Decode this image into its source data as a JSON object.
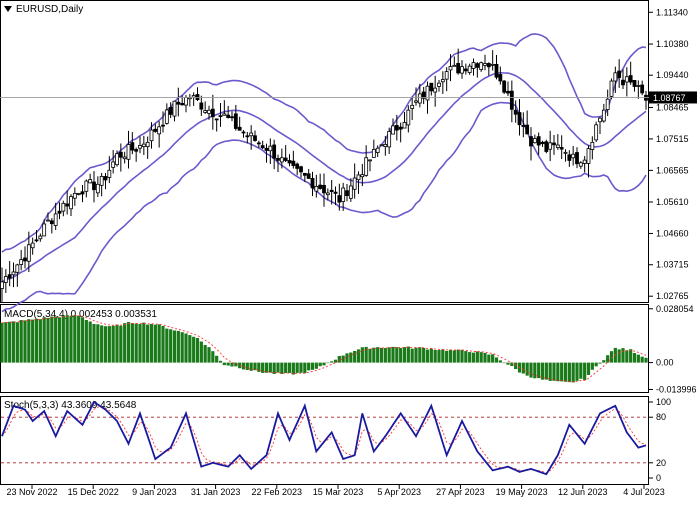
{
  "chart_data": [
    {
      "type": "candlestick",
      "title": "EURUSD,Daily",
      "ylim": [
        1.0262,
        1.1165
      ],
      "y_ticks": [
        "1.11340",
        "1.10380",
        "1.09440",
        "1.08465",
        "1.07515",
        "1.06565",
        "1.05610",
        "1.04660",
        "1.03715",
        "1.02765"
      ],
      "current_price": "1.08767",
      "colors": {
        "candle": "#000000",
        "bollinger": "#6a5acd",
        "price_line": "#9a9a9a"
      },
      "indicators": [
        "Bollinger Bands"
      ]
    },
    {
      "type": "bar",
      "title": "MACD(5,34,4) 0.002453 0.003531",
      "ylim": [
        -0.0148,
        0.0295
      ],
      "y_ticks": [
        "0.028054",
        "0.00",
        "-0.013996"
      ],
      "colors": {
        "histogram": "#1a7a1a",
        "signal": "#ff3333"
      }
    },
    {
      "type": "line",
      "title": "Stoch(5,3,3) 43.3609 43.5648",
      "ylim": [
        0,
        100
      ],
      "y_ticks": [
        "100",
        "80",
        "20",
        "0"
      ],
      "levels": [
        80,
        20
      ],
      "colors": {
        "main": "#1a1aa0",
        "signal": "#ff3333",
        "levels": "#aa2222"
      }
    }
  ],
  "x_ticks": [
    "23 Nov 2022",
    "15 Dec 2022",
    "9 Jan 2023",
    "31 Jan 2023",
    "22 Feb 2023",
    "15 Mar 2023",
    "5 Apr 2023",
    "27 Apr 2023",
    "19 May 2023",
    "12 Jun 2023",
    "4 Jul 2023"
  ],
  "series_anchors": {
    "price": [
      [
        0,
        1.032
      ],
      [
        6,
        1.04
      ],
      [
        12,
        1.05
      ],
      [
        20,
        1.06
      ],
      [
        26,
        1.062
      ],
      [
        30,
        1.07
      ],
      [
        36,
        1.073
      ],
      [
        40,
        1.078
      ],
      [
        45,
        1.085
      ],
      [
        49,
        1.088
      ],
      [
        54,
        1.084
      ],
      [
        58,
        1.082
      ],
      [
        63,
        1.077
      ],
      [
        70,
        1.072
      ],
      [
        75,
        1.066
      ],
      [
        80,
        1.063
      ],
      [
        84,
        1.06
      ],
      [
        88,
        1.057
      ],
      [
        92,
        1.063
      ],
      [
        96,
        1.069
      ],
      [
        100,
        1.075
      ],
      [
        104,
        1.08
      ],
      [
        108,
        1.086
      ],
      [
        112,
        1.091
      ],
      [
        115,
        1.095
      ],
      [
        118,
        1.096
      ],
      [
        122,
        1.098
      ],
      [
        126,
        1.099
      ],
      [
        130,
        1.094
      ],
      [
        134,
        1.083
      ],
      [
        138,
        1.075
      ],
      [
        142,
        1.072
      ],
      [
        146,
        1.073
      ],
      [
        149,
        1.069
      ],
      [
        152,
        1.07
      ],
      [
        155,
        1.079
      ],
      [
        158,
        1.087
      ],
      [
        160,
        1.095
      ],
      [
        162,
        1.093
      ],
      [
        165,
        1.091
      ],
      [
        168,
        1.087
      ]
    ],
    "macd": [
      [
        0,
        0.0205
      ],
      [
        6,
        0.022
      ],
      [
        14,
        0.024
      ],
      [
        20,
        0.0245
      ],
      [
        24,
        0.0205
      ],
      [
        28,
        0.0185
      ],
      [
        34,
        0.021
      ],
      [
        40,
        0.02
      ],
      [
        45,
        0.017
      ],
      [
        50,
        0.014
      ],
      [
        54,
        0.008
      ],
      [
        58,
        -0.001
      ],
      [
        62,
        -0.0025
      ],
      [
        66,
        -0.0045
      ],
      [
        70,
        -0.0055
      ],
      [
        74,
        -0.006
      ],
      [
        78,
        -0.0055
      ],
      [
        82,
        -0.0035
      ],
      [
        86,
        0.001
      ],
      [
        90,
        0.005
      ],
      [
        94,
        0.0075
      ],
      [
        98,
        0.008
      ],
      [
        104,
        0.008
      ],
      [
        110,
        0.0075
      ],
      [
        116,
        0.0065
      ],
      [
        122,
        0.006
      ],
      [
        128,
        0.004
      ],
      [
        132,
        -0.001
      ],
      [
        136,
        -0.006
      ],
      [
        140,
        -0.0085
      ],
      [
        144,
        -0.01
      ],
      [
        148,
        -0.0105
      ],
      [
        152,
        -0.0085
      ],
      [
        156,
        0.0
      ],
      [
        160,
        0.0075
      ],
      [
        164,
        0.0065
      ],
      [
        168,
        0.0025
      ]
    ],
    "stoch": [
      [
        0,
        55
      ],
      [
        3,
        95
      ],
      [
        6,
        90
      ],
      [
        8,
        75
      ],
      [
        11,
        88
      ],
      [
        14,
        55
      ],
      [
        17,
        88
      ],
      [
        21,
        70
      ],
      [
        24,
        100
      ],
      [
        27,
        90
      ],
      [
        30,
        75
      ],
      [
        33,
        45
      ],
      [
        36,
        85
      ],
      [
        40,
        25
      ],
      [
        44,
        40
      ],
      [
        48,
        85
      ],
      [
        52,
        15
      ],
      [
        55,
        20
      ],
      [
        59,
        15
      ],
      [
        62,
        30
      ],
      [
        65,
        12
      ],
      [
        69,
        30
      ],
      [
        72,
        85
      ],
      [
        75,
        50
      ],
      [
        79,
        95
      ],
      [
        82,
        35
      ],
      [
        86,
        60
      ],
      [
        89,
        25
      ],
      [
        92,
        30
      ],
      [
        94,
        85
      ],
      [
        97,
        35
      ],
      [
        100,
        55
      ],
      [
        104,
        85
      ],
      [
        108,
        55
      ],
      [
        112,
        95
      ],
      [
        116,
        30
      ],
      [
        120,
        75
      ],
      [
        124,
        35
      ],
      [
        128,
        10
      ],
      [
        132,
        15
      ],
      [
        135,
        8
      ],
      [
        138,
        12
      ],
      [
        142,
        5
      ],
      [
        145,
        30
      ],
      [
        148,
        70
      ],
      [
        152,
        45
      ],
      [
        156,
        85
      ],
      [
        160,
        95
      ],
      [
        163,
        60
      ],
      [
        166,
        40
      ],
      [
        168,
        43
      ]
    ]
  }
}
